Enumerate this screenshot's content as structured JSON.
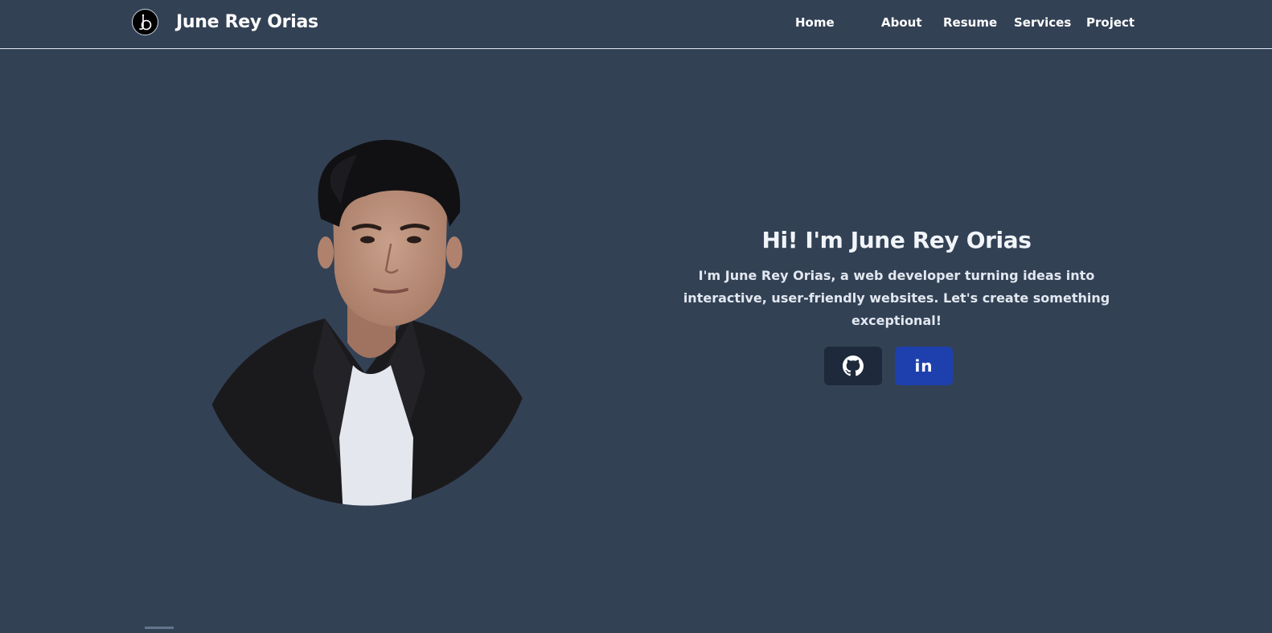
{
  "header": {
    "brand_name": "June Rey Orias",
    "logo_icon": "jo-monogram-logo"
  },
  "nav": {
    "items": [
      {
        "label": "Home"
      },
      {
        "label": "About"
      },
      {
        "label": "Resume"
      },
      {
        "label": "Services"
      },
      {
        "label": "Project"
      }
    ]
  },
  "hero": {
    "title": "Hi! I'm June Rey Orias",
    "description": "I'm June Rey Orias, a web developer turning ideas into interactive, user-friendly websites. Let's create something exceptional!",
    "portrait_icon": "profile-photo"
  },
  "social": {
    "github_icon": "github-icon",
    "linkedin_label": "in",
    "linkedin_icon": "linkedin-icon"
  },
  "colors": {
    "background": "#334155",
    "github_button": "#1e293b",
    "linkedin_button": "#1e40af",
    "text": "#f1f5f9"
  }
}
